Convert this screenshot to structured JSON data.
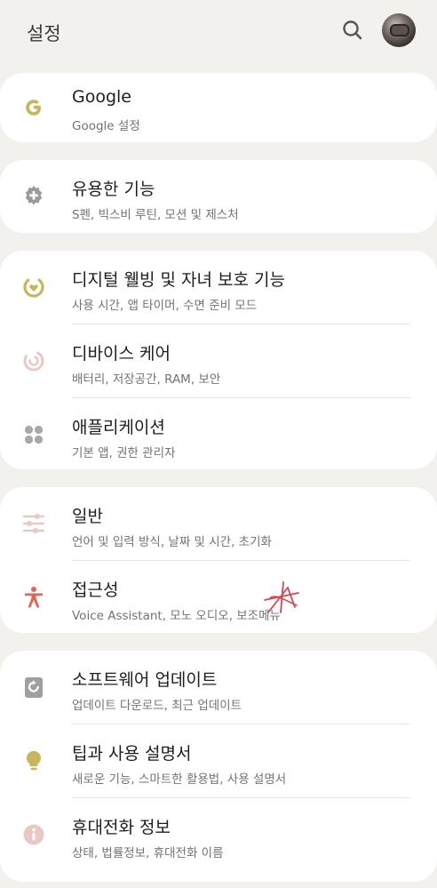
{
  "header": {
    "title": "설정"
  },
  "sections": [
    {
      "items": [
        {
          "label": "Google",
          "sub": "Google 설정"
        }
      ]
    },
    {
      "items": [
        {
          "label": "유용한 기능",
          "sub": "S펜, 빅스비 루틴, 모션 및 제스처"
        }
      ]
    },
    {
      "items": [
        {
          "label": "디지털 웰빙 및 자녀 보호 기능",
          "sub": "사용 시간, 앱 타이머, 수면 준비 모드"
        },
        {
          "label": "디바이스 케어",
          "sub": "배터리, 저장공간, RAM, 보안"
        },
        {
          "label": "애플리케이션",
          "sub": "기본 앱, 권한 관리자"
        }
      ]
    },
    {
      "items": [
        {
          "label": "일반",
          "sub": "언어 및 입력 방식, 날짜 및 시간, 초기화"
        },
        {
          "label": "접근성",
          "sub": "Voice Assistant, 모노 오디오, 보조메뉴"
        }
      ]
    },
    {
      "items": [
        {
          "label": "소프트웨어 업데이트",
          "sub": "업데이트 다운로드, 최근 업데이트"
        },
        {
          "label": "팁과 사용 설명서",
          "sub": "새로운 기능, 스마트한 활용법, 사용 설명서"
        },
        {
          "label": "휴대전화 정보",
          "sub": "상태, 법률정보, 휴대전화 이름"
        }
      ]
    }
  ],
  "colors": {
    "background": "#f2f1ed",
    "card": "#ffffff",
    "google_icon": "#c9b65a",
    "gear_icon": "#9a9a9a",
    "wellbeing_icon": "#c9b65a",
    "device_care_icon": "#e8c9c4",
    "apps_icon": "#a8a8a8",
    "general_icon": "#e8c9c4",
    "accessibility_icon": "#e0665a",
    "software_update_icon": "#a0a0a0",
    "tips_icon": "#c9b65a",
    "info_icon": "#e8c9c4"
  },
  "icons": [
    "google-icon",
    "gear-plus-icon",
    "wellbeing-icon",
    "device-care-icon",
    "apps-grid-icon",
    "sliders-icon",
    "accessibility-icon",
    "software-update-icon",
    "lightbulb-icon",
    "info-icon"
  ]
}
